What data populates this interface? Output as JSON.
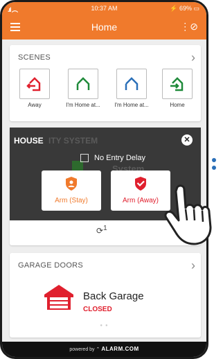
{
  "status_bar": {
    "time": "10:37 AM",
    "battery": "69%"
  },
  "header": {
    "title": "Home"
  },
  "scenes": {
    "title": "SCENES",
    "items": [
      {
        "label": "Away",
        "color": "#e0202e"
      },
      {
        "label": "I'm Home at...",
        "color": "#1f8a3a"
      },
      {
        "label": "I'm Home at...",
        "color": "#2a6fb8"
      },
      {
        "label": "Home",
        "color": "#1f8a3a"
      }
    ]
  },
  "security_overlay": {
    "panel_title": "HOUSE",
    "hidden_text": "ITY SYSTEM",
    "hidden_text_2": "System",
    "no_entry_delay_label": "No Entry Delay",
    "arm_stay_label": "Arm (Stay)",
    "arm_away_label": "Arm (Away)",
    "sensor_badge": "1"
  },
  "garage": {
    "title": "GARAGE DOORS",
    "door_name": "Back Garage",
    "door_status": "CLOSED"
  },
  "footer": {
    "powered_by": "powered by",
    "brand": "ALARM.COM"
  },
  "colors": {
    "accent": "#f07a2c",
    "danger": "#e0202e"
  }
}
